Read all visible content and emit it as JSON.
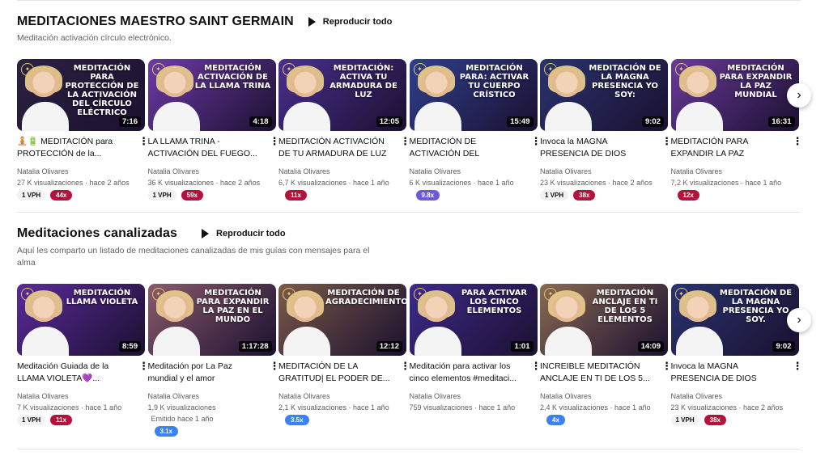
{
  "shelves": [
    {
      "title": "MEDITACIONES MAESTRO SAINT GERMAIN",
      "play_all": "Reproducir todo",
      "description": "Meditación activación círculo electrónico.",
      "videos": [
        {
          "thumb_text": "MEDITACIÓN PARA PROTECCIÓN DE LA ACTIVACIÓN DEL CÍRCULO ELÉCTRICO",
          "bg": "#2b2140",
          "duration": "7:16",
          "title": "🧘🏼🔋 MEDITACIÓN para PROTECCIÓN de la...",
          "channel": "Natalia Olivares",
          "stats": "27 K visualizaciones · hace 2 años",
          "vph": "1 VPH",
          "mult": "44x",
          "mult_color": "#b3123a"
        },
        {
          "thumb_text": "MEDITACIÓN ACTIVACIÓN DE LA LLAMA TRINA",
          "bg": "#6e3aa8",
          "duration": "4:18",
          "title": "LA LLAMA TRINA - ACTIVACIÓN DEL FUEGO...",
          "channel": "Natalia Olivares",
          "stats": "36 K visualizaciones · hace 2 años",
          "vph": "1 VPH",
          "mult": "59x",
          "mult_color": "#b3123a"
        },
        {
          "thumb_text": "MEDITACIÓN: ACTIVA TU ARMADURA DE LUZ",
          "bg": "#4a2f8f",
          "duration": "12:05",
          "title": "MEDITACIÓN ACTIVACIÓN DE TU ARMADURA DE LUZ |...",
          "channel": "Natalia Olivares",
          "stats": "6,7 K visualizaciones · hace 1 año",
          "vph": "",
          "mult": "11x",
          "mult_color": "#b3123a"
        },
        {
          "thumb_text": "MEDITACIÓN PARA: ACTIVAR TU CUERPO CRÍSTICO",
          "bg": "#2e3f8c",
          "duration": "15:49",
          "title": "MEDITACIÓN DE ACTIVACIÓN DEL CUERPO...",
          "channel": "Natalia Olivares",
          "stats": "6 K visualizaciones · hace 1 año",
          "vph": "",
          "mult": "9.8x",
          "mult_color": "#6a5ae0"
        },
        {
          "thumb_text": "MEDITACIÓN DE LA MAGNA PRESENCIA YO SOY:",
          "bg": "#28346e",
          "duration": "9:02",
          "title": "Invoca la MAGNA PRESENCIA DE DIOS ⚡YO...",
          "channel": "Natalia Olivares",
          "stats": "23 K visualizaciones · hace 2 años",
          "vph": "1 VPH",
          "mult": "38x",
          "mult_color": "#b3123a"
        },
        {
          "thumb_text": "MEDITACIÓN PARA EXPANDIR LA PAZ MUNDIAL",
          "bg": "#6a3a9a",
          "duration": "16:31",
          "title": "MEDITACIÓN PARA EXPANDIR LA PAZ MUNDIA...",
          "channel": "Natalia Olivares",
          "stats": "7,2 K visualizaciones · hace 1 año",
          "vph": "",
          "mult": "12x",
          "mult_color": "#b3123a"
        }
      ]
    },
    {
      "title": "Meditaciones canalizadas",
      "play_all": "Reproducir todo",
      "description": "Aquí les comparto un listado de meditaciones canalizadas de mis guías con mensajes para el alma",
      "videos": [
        {
          "thumb_text": "MEDITACIÓN LLAMA VIOLETA",
          "bg": "#5a2a9a",
          "duration": "8:59",
          "title": "Meditación Guiada de la LLAMA VIOLETA💜...",
          "channel": "Natalia Olivares",
          "stats": "7 K visualizaciones · hace 1 año",
          "vph": "1 VPH",
          "mult": "11x",
          "mult_color": "#b3123a"
        },
        {
          "thumb_text": "MEDITACIÓN PARA EXPANDIR LA PAZ EN EL MUNDO",
          "bg": "#8a5a6a",
          "duration": "1:17:28",
          "title": "Meditación por La Paz mundial y el amor",
          "channel": "Natalia Olivares",
          "stats": "1,9 K visualizaciones",
          "stats2": "Emitido hace 1 año",
          "vph": "",
          "mult": "3.1x",
          "mult_color": "#3b82f6"
        },
        {
          "thumb_text": "MEDITACIÓN DE AGRADECIMIENTO",
          "bg": "#7a5a48",
          "duration": "12:12",
          "title": "MEDITACIÓN DE LA GRATITUD| EL PODER DE...",
          "channel": "Natalia Olivares",
          "stats": "2,1 K visualizaciones · hace 1 año",
          "vph": "",
          "mult": "3.5x",
          "mult_color": "#3b82f6"
        },
        {
          "thumb_text": "PARA ACTIVAR LOS CINCO ELEMENTOS",
          "bg": "#3d2a8a",
          "duration": "1:01",
          "title": "Meditación para activar los cinco elementos #meditaci...",
          "channel": "Natalia Olivares",
          "stats": "759 visualizaciones · hace 1 año",
          "vph": "",
          "mult": "",
          "mult_color": "#3b82f6"
        },
        {
          "thumb_text": "MEDITACIÓN ANCLAJE EN TI DE LOS 5 ELEMENTOS",
          "bg": "#8a6a52",
          "duration": "14:09",
          "title": "INCREIBLE MEDITACIÓN ANCLAJE EN TI DE LOS 5...",
          "channel": "Natalia Olivares",
          "stats": "2,4 K visualizaciones · hace 1 año",
          "vph": "",
          "mult": "4x",
          "mult_color": "#3b82f6"
        },
        {
          "thumb_text": "MEDITACIÓN DE LA MAGNA PRESENCIA YO SOY.",
          "bg": "#28346e",
          "duration": "9:02",
          "title": "Invoca la MAGNA PRESENCIA DE DIOS ⚡YO...",
          "channel": "Natalia Olivares",
          "stats": "23 K visualizaciones · hace 2 años",
          "vph": "1 VPH",
          "mult": "38x",
          "mult_color": "#b3123a"
        }
      ]
    }
  ],
  "icons": {
    "next": "chevron-right-icon",
    "more": "more-vertical-icon",
    "play": "play-icon"
  }
}
